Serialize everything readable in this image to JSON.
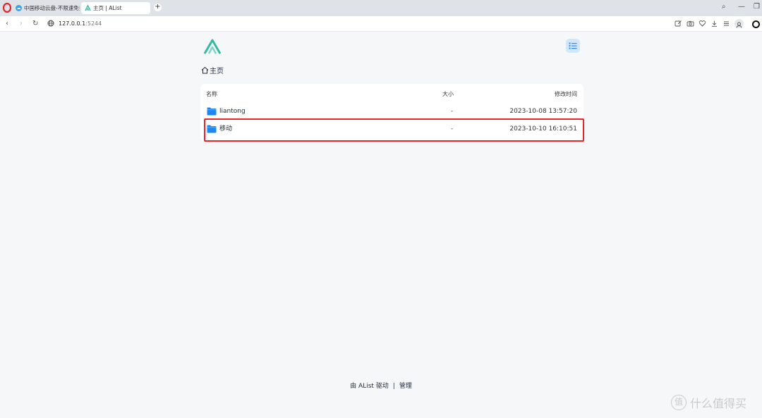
{
  "browser": {
    "tabs": [
      {
        "title": "中国移动云盘-不限速免费",
        "favicon": "cloud-icon"
      },
      {
        "title": "主页 | AList",
        "favicon": "alist-logo-icon"
      }
    ],
    "url": {
      "host": "127.0.0.1",
      "port": ":5244"
    },
    "new_tab_label": "+",
    "window_controls": {
      "search": "⌕",
      "minimize": "—",
      "restore": "❐"
    },
    "nav": {
      "back": "‹",
      "forward": "›",
      "reload": "↻"
    }
  },
  "page": {
    "breadcrumb": {
      "home_label": "主页"
    },
    "columns": {
      "name": "名称",
      "size": "大小",
      "mtime": "修改时间"
    },
    "files": [
      {
        "name": "liantong",
        "size": "-",
        "mtime": "2023-10-08 13:57:20",
        "type": "folder"
      },
      {
        "name": "移动",
        "size": "-",
        "mtime": "2023-10-10 16:10:51",
        "type": "folder",
        "highlighted": true
      }
    ],
    "footer": {
      "powered_by": "由 AList 驱动",
      "separator": "|",
      "admin_link": "管理"
    }
  },
  "watermark": {
    "text": "什么值得买",
    "badge": "值"
  },
  "colors": {
    "accent": "#2b8cf3",
    "logo": "#35b9a3",
    "highlight_border": "#e8262b",
    "background": "#f6f7f9"
  }
}
